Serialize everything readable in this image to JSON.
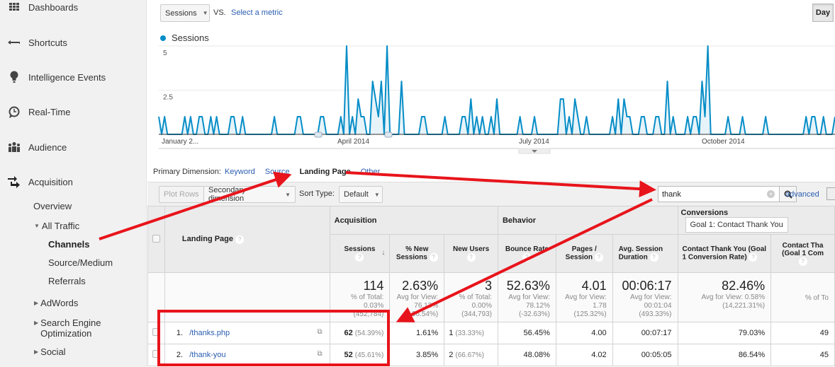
{
  "sidebar": {
    "items": [
      {
        "label": "Dashboards",
        "icon": "dashboard-grid-icon"
      },
      {
        "label": "Shortcuts",
        "icon": "shortcut-arrow-icon"
      },
      {
        "label": "Intelligence Events",
        "icon": "lightbulb-icon"
      },
      {
        "label": "Real-Time",
        "icon": "clock-icon"
      },
      {
        "label": "Audience",
        "icon": "people-icon"
      },
      {
        "label": "Acquisition",
        "icon": "acquisition-arrows-icon"
      }
    ],
    "acquisition_sub": {
      "overview": "Overview",
      "all_traffic": "All Traffic",
      "channels": "Channels",
      "source_medium": "Source/Medium",
      "referrals": "Referrals",
      "adwords": "AdWords",
      "seo_line1": "Search Engine",
      "seo_line2": "Optimization",
      "social": "Social"
    }
  },
  "graph_controls": {
    "metric": "Sessions",
    "vs": "VS.",
    "select_metric": "Select a metric",
    "day_button": "Day",
    "legend": "Sessions",
    "series_color": "#058dc7"
  },
  "chart_data": {
    "type": "area",
    "title": "",
    "series": [
      {
        "name": "Sessions",
        "color": "#058dc7"
      }
    ],
    "y_ticks": [
      "5",
      "2.5"
    ],
    "ylim": [
      0,
      5
    ],
    "x_ticks": [
      "January 2...",
      "April 2014",
      "July 2014",
      "October 2014"
    ],
    "grid": true,
    "values": [
      1,
      0,
      1,
      0,
      0,
      0,
      0,
      0,
      0,
      1,
      0,
      1,
      0,
      0,
      1,
      1,
      0,
      0,
      1,
      0,
      1,
      0,
      0,
      0,
      0,
      1,
      1,
      0,
      0,
      1,
      0,
      0,
      0,
      0,
      0,
      0,
      0,
      0,
      0,
      0,
      1,
      0,
      0,
      0,
      0,
      0,
      0,
      0,
      1,
      1,
      0,
      0,
      0,
      0,
      0,
      0,
      1,
      1,
      0,
      0,
      0,
      0,
      0,
      1,
      0,
      5,
      0,
      1,
      0,
      2,
      1,
      1,
      0,
      0,
      3,
      2,
      1,
      3,
      0,
      5,
      0,
      0,
      0,
      0,
      3,
      0,
      0,
      0,
      0,
      0,
      0,
      1,
      1,
      0,
      0,
      0,
      0,
      0,
      0,
      1,
      0,
      0,
      0,
      0,
      0,
      1,
      1,
      0,
      2,
      0,
      1,
      0,
      1,
      0,
      0,
      1,
      0,
      2,
      0,
      0,
      0,
      0,
      0,
      0,
      0,
      1,
      0,
      0,
      0,
      0,
      1,
      0,
      0,
      0,
      0,
      0,
      0,
      0,
      0,
      2,
      2,
      0,
      1,
      0,
      2,
      1,
      0,
      0,
      1,
      0,
      0,
      0,
      0,
      0,
      0,
      0,
      0,
      1,
      0,
      2,
      0,
      2,
      1,
      1,
      0,
      0,
      0,
      1,
      1,
      0,
      0,
      0,
      1,
      1,
      0,
      0,
      3,
      0,
      1,
      0,
      0,
      0,
      0,
      1,
      0,
      1,
      1,
      0,
      3,
      1,
      5,
      0,
      0,
      0,
      0,
      0,
      0,
      1,
      0,
      0,
      0,
      0,
      1,
      0,
      0,
      0,
      0,
      0,
      0,
      0,
      1,
      0,
      0,
      0,
      0,
      0,
      0,
      0,
      0,
      0,
      0,
      0,
      0,
      0,
      1,
      0,
      1,
      1,
      0,
      0,
      1,
      0,
      0,
      0,
      1
    ]
  },
  "dimension_bar": {
    "label": "Primary Dimension:",
    "options": [
      "Keyword",
      "Source",
      "Landing Page",
      "Other"
    ],
    "active": "Landing Page"
  },
  "toolbar": {
    "plot_rows": "Plot Rows",
    "secondary_dimension": "Secondary dimension",
    "sort_type_label": "Sort Type:",
    "sort_type_value": "Default",
    "search_value": "thank",
    "advanced": "advanced"
  },
  "table": {
    "dimension_header": "Landing Page",
    "groups": {
      "acquisition": "Acquisition",
      "behavior": "Behavior",
      "conversions": "Conversions",
      "goal_select": "Goal 1: Contact Thank You"
    },
    "columns": [
      {
        "line1": "Sessions",
        "line2": ""
      },
      {
        "line1": "% New",
        "line2": "Sessions"
      },
      {
        "line1": "New Users",
        "line2": ""
      },
      {
        "line1": "Bounce Rate",
        "line2": ""
      },
      {
        "line1": "Pages /",
        "line2": "Session"
      },
      {
        "line1": "Avg. Session",
        "line2": "Duration"
      },
      {
        "line1": "Contact Thank You (Goal",
        "line2": "1 Conversion Rate)"
      },
      {
        "line1": "Contact Tha",
        "line2": "(Goal 1 Com"
      }
    ],
    "totals": [
      {
        "value": "114",
        "sub1": "% of Total:",
        "sub2": "0.03%",
        "sub3": "(452,784)"
      },
      {
        "value": "2.63%",
        "sub1": "Avg for View:",
        "sub2": "76.13%",
        "sub3": "(-96.54%)"
      },
      {
        "value": "3",
        "sub1": "% of Total:",
        "sub2": "0.00%",
        "sub3": "(344,793)"
      },
      {
        "value": "52.63%",
        "sub1": "Avg for View:",
        "sub2": "78.12%",
        "sub3": "(-32.63%)"
      },
      {
        "value": "4.01",
        "sub1": "Avg for View:",
        "sub2": "1.78",
        "sub3": "(125.32%)"
      },
      {
        "value": "00:06:17",
        "sub1": "Avg for View:",
        "sub2": "00:01:04",
        "sub3": "(493.33%)"
      },
      {
        "value": "82.46%",
        "sub1": "Avg for View: 0.58%",
        "sub2": "(14,221.31%)",
        "sub3": ""
      },
      {
        "value": "",
        "sub1": "% of To",
        "sub2": "",
        "sub3": ""
      }
    ],
    "rows": [
      {
        "index": "1.",
        "page": "/thanks.php",
        "sessions": "62",
        "sessions_pct": "(54.39%)",
        "new_sessions": "1.61%",
        "new_users": "1",
        "new_users_pct": "(33.33%)",
        "bounce": "56.45%",
        "pages": "4.00",
        "duration": "00:07:17",
        "conv_rate": "79.03%",
        "completions": "49"
      },
      {
        "index": "2.",
        "page": "/thank-you",
        "sessions": "52",
        "sessions_pct": "(45.61%)",
        "new_sessions": "3.85%",
        "new_users": "2",
        "new_users_pct": "(66.67%)",
        "bounce": "48.08%",
        "pages": "4.02",
        "duration": "00:05:05",
        "conv_rate": "86.54%",
        "completions": "45"
      }
    ]
  },
  "annotation_color": "#e8141b"
}
